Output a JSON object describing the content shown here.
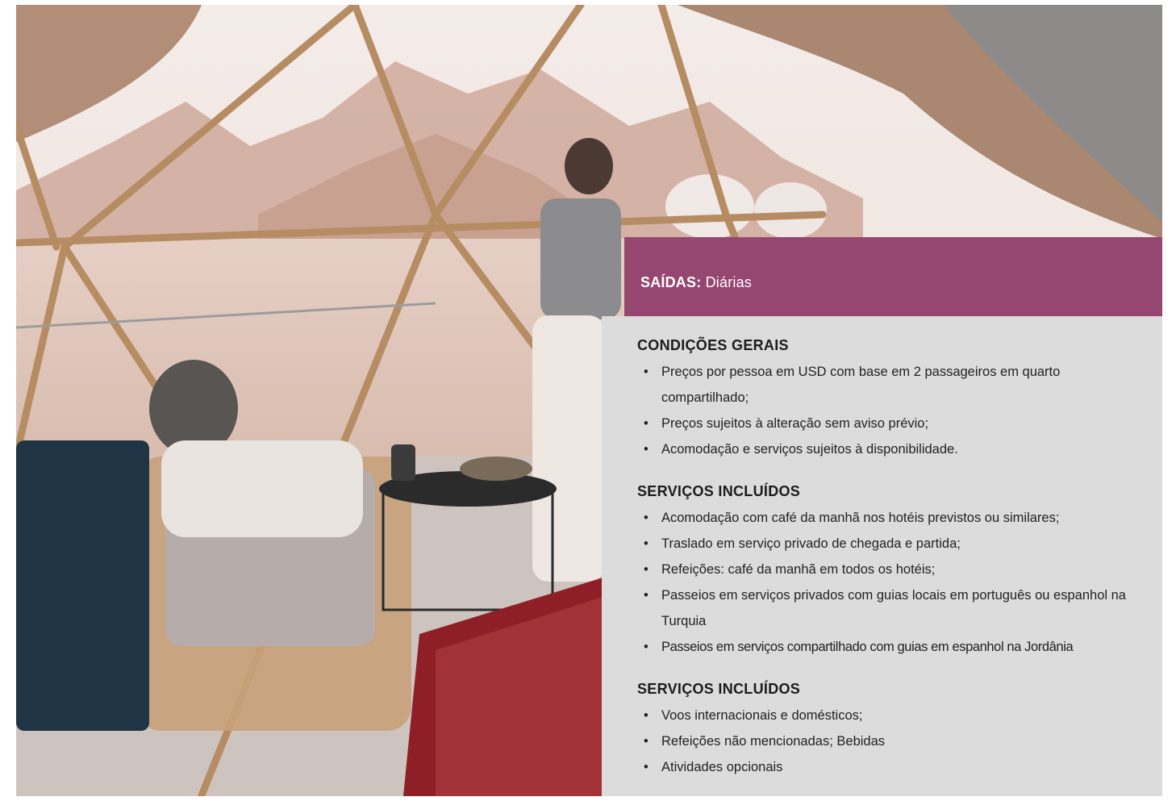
{
  "departures": {
    "label": "SAÍDAS:",
    "value": "Diárias"
  },
  "sections": [
    {
      "title": "CONDIÇÕES GERAIS",
      "items": [
        "Preços por pessoa em USD com base em 2 passageiros em quarto compartilhado;",
        "Preços sujeitos à alteração sem aviso prévio;",
        "Acomodação e serviços sujeitos à disponibilidade."
      ]
    },
    {
      "title": "SERVIÇOS INCLUÍDOS",
      "items": [
        "Acomodação com café da manhã nos hotéis previstos ou similares;",
        "Traslado em serviço privado de chegada e partida;",
        "Refeições: café da manhã em todos os hotéis;",
        "Passeios em serviços privados com guias locais em português ou espanhol na Turquia",
        "Passeios em serviços compartilhado com guias em espanhol na Jordânia"
      ]
    },
    {
      "title": "SERVIÇOS INCLUÍDOS",
      "items": [
        "Voos internacionais e domésticos;",
        "Refeições não mencionadas; Bebidas",
        "Atividades opcionais"
      ]
    }
  ],
  "colors": {
    "header_bg": "#964771",
    "panel_bg": "#dcdcdc"
  }
}
